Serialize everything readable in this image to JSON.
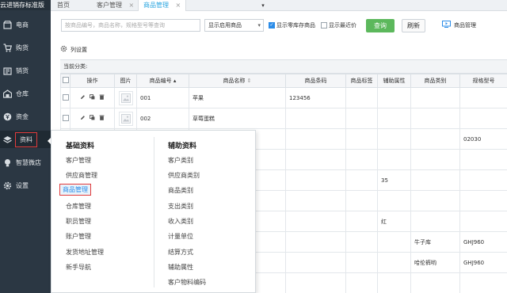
{
  "app": {
    "brand": "云进销存标准版",
    "nav": [
      {
        "label": "电商",
        "icon": "store-icon"
      },
      {
        "label": "购货",
        "icon": "cart-icon"
      },
      {
        "label": "销货",
        "icon": "sales-icon"
      },
      {
        "label": "仓库",
        "icon": "warehouse-icon"
      },
      {
        "label": "资金",
        "icon": "money-icon"
      },
      {
        "label": "资料",
        "icon": "layers-icon",
        "active": true
      },
      {
        "label": "智慧微店",
        "icon": "bulb-icon"
      },
      {
        "label": "设置",
        "icon": "gear-icon"
      }
    ]
  },
  "tabs": {
    "home": "首页",
    "customer": "客户管理",
    "product": "商品管理",
    "close_glyph": "×",
    "dropdown_glyph": "▾"
  },
  "toolbar": {
    "search_placeholder": "按商品编号，商品名称，规格型号等查询",
    "status_select": "显示启用商品",
    "show_zero_stock": "显示零库存商品",
    "show_recent_price": "显示最近价",
    "query": "查询",
    "refresh": "刷新",
    "product_mgmt": "商品管理"
  },
  "column_settings": "列设置",
  "grid": {
    "category_label": "当前分类:",
    "headers": [
      "",
      "操作",
      "图片",
      "商品编号",
      "商品名称",
      "商品条码",
      "商品标签",
      "辅助属性",
      "商品类别",
      "规格型号"
    ],
    "rows": [
      [
        "",
        "",
        "",
        "001",
        "苹果",
        "123456",
        "",
        "",
        "",
        ""
      ],
      [
        "",
        "",
        "",
        "002",
        "草莓蛋糕",
        "",
        "",
        "",
        "",
        ""
      ],
      [
        "",
        "",
        "",
        "",
        "",
        "",
        "",
        "",
        "",
        "02030"
      ],
      [
        "",
        "",
        "",
        "",
        "",
        "",
        "",
        "",
        "",
        ""
      ],
      [
        "",
        "",
        "",
        "",
        "",
        "",
        "",
        "35",
        "",
        ""
      ],
      [
        "",
        "",
        "",
        "",
        "",
        "",
        "",
        "",
        "",
        ""
      ],
      [
        "",
        "",
        "",
        "",
        "",
        "",
        "",
        "红",
        "",
        ""
      ],
      [
        "",
        "",
        "",
        "",
        "",
        "",
        "",
        "",
        "牛子库",
        "GHJ960"
      ],
      [
        "",
        "",
        "",
        "",
        "",
        "",
        "",
        "",
        "哈伦裤哟",
        "GHJ960"
      ],
      [
        "",
        "",
        "",
        "",
        "",
        "",
        "",
        "",
        "",
        ""
      ]
    ]
  },
  "menu": {
    "left_title": "基础资料",
    "left_items": [
      "客户管理",
      "供应商管理",
      "商品管理",
      "仓库管理",
      "职员管理",
      "账户管理",
      "发货地址管理",
      "新手导航"
    ],
    "right_title": "辅助资料",
    "right_items": [
      "客户类别",
      "供应商类别",
      "商品类别",
      "支出类别",
      "收入类别",
      "计量单位",
      "结算方式",
      "辅助属性",
      "客户物料编码"
    ]
  }
}
